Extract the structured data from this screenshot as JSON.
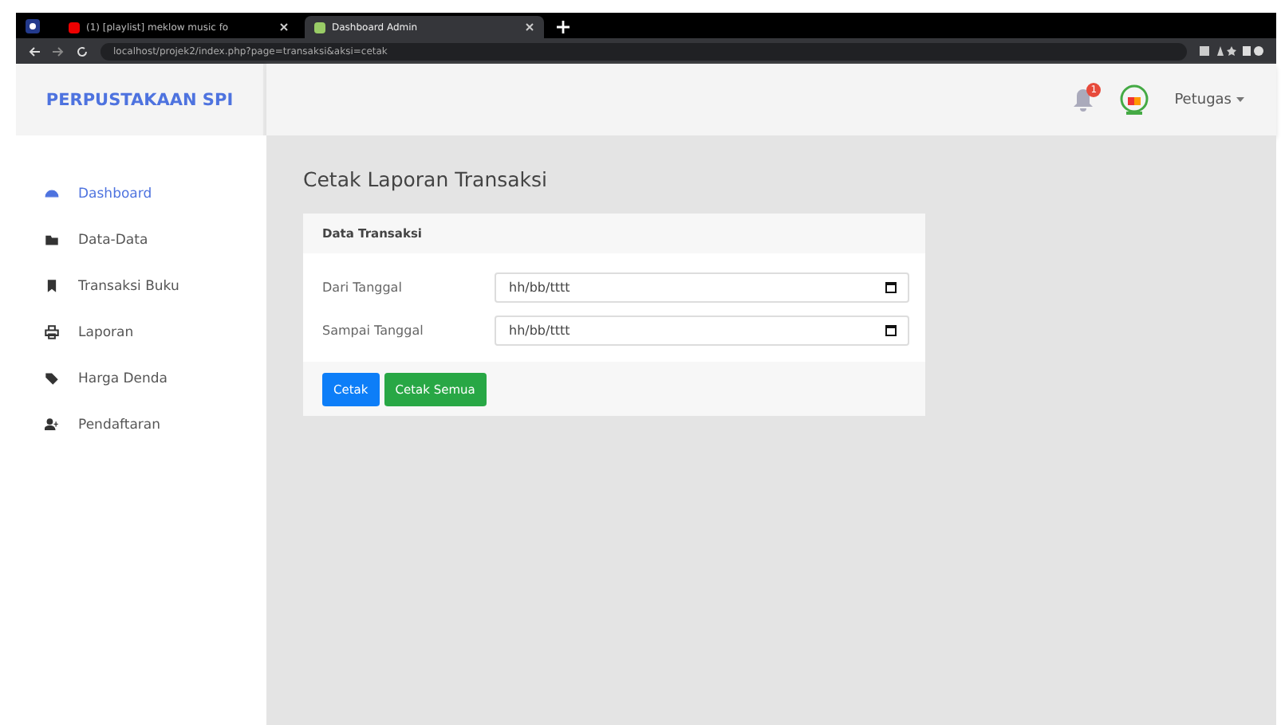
{
  "browser": {
    "tabs": [
      {
        "title": "(1) [playlist] meklow music fo",
        "selected": false
      },
      {
        "title": "Dashboard Admin",
        "selected": true
      }
    ],
    "url": "localhost/projek2/index.php?page=transaksi&aksi=cetak"
  },
  "header": {
    "brand": "PERPUSTAKAAN SPI",
    "notification_count": "1",
    "user": "Petugas"
  },
  "sidebar": {
    "items": [
      {
        "label": "Dashboard",
        "selected": true
      },
      {
        "label": "Data-Data",
        "selected": false
      },
      {
        "label": "Transaksi Buku",
        "selected": false
      },
      {
        "label": "Laporan",
        "selected": false
      },
      {
        "label": "Harga Denda",
        "selected": false
      },
      {
        "label": "Pendaftaran",
        "selected": false
      }
    ]
  },
  "page_title": "Cetak Laporan Transaksi",
  "card": {
    "title": "Data Transaksi",
    "fields": [
      {
        "label": "Dari Tanggal",
        "placeholder": "hh/bb/tttt"
      },
      {
        "label": "Sampai Tanggal",
        "placeholder": "hh/bb/tttt"
      }
    ],
    "buttons": [
      {
        "label": "Cetak",
        "kind": "primary"
      },
      {
        "label": "Cetak Semua",
        "kind": "success"
      }
    ]
  }
}
